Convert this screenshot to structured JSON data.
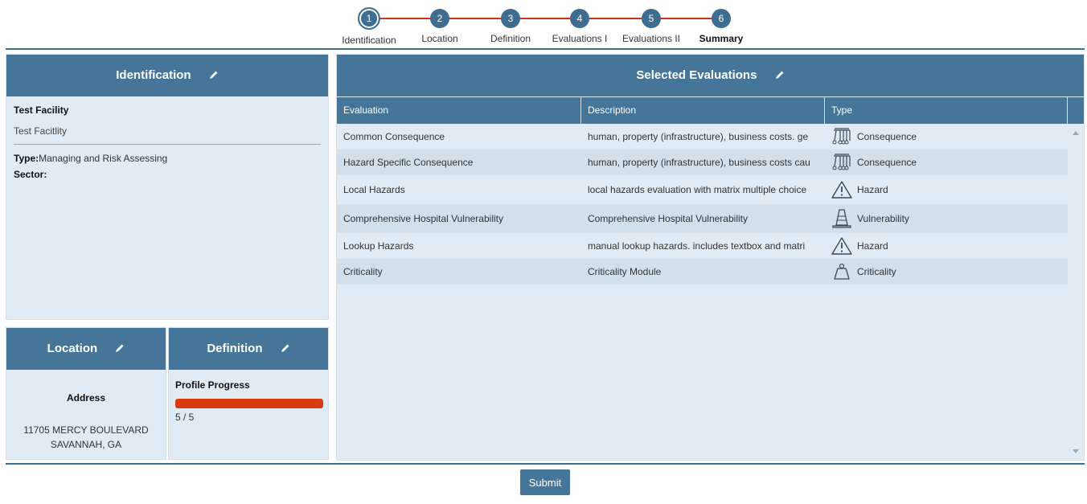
{
  "stepper": {
    "steps": [
      {
        "number": "1",
        "label": "Identification"
      },
      {
        "number": "2",
        "label": "Location"
      },
      {
        "number": "3",
        "label": "Definition"
      },
      {
        "number": "4",
        "label": "Evaluations I"
      },
      {
        "number": "5",
        "label": "Evaluations II"
      },
      {
        "number": "6",
        "label": "Summary"
      }
    ],
    "active_step": "1",
    "current_step": "6",
    "line_color": "#c7331f",
    "circle_color": "#3f6d90"
  },
  "identification": {
    "title": "Identification",
    "facility_name": "Test Facility",
    "facility_subtitle": "Test Facitlity",
    "type_label": "Type:",
    "type_value": "Managing and Risk Assessing",
    "sector_label": "Sector:",
    "sector_value": ""
  },
  "location": {
    "title": "Location",
    "address_heading": "Address",
    "address_line1": "11705 MERCY BOULEVARD",
    "address_line2": "SAVANNAH, GA"
  },
  "definition": {
    "title": "Definition",
    "progress_heading": "Profile Progress",
    "progress_fraction": 1.0,
    "progress_text": "5 / 5",
    "progress_color": "#d93a0f"
  },
  "evaluations": {
    "title": "Selected Evaluations",
    "columns": [
      "Evaluation",
      "Description",
      "Type"
    ],
    "rows": [
      {
        "evaluation": "Common Consequence",
        "description": "human, property (infrastructure), business costs. ge",
        "type": "Consequence",
        "icon": "newtons-cradle-icon"
      },
      {
        "evaluation": "Hazard Specific Consequence",
        "description": "human, property (infrastructure), business costs cau",
        "type": "Consequence",
        "icon": "newtons-cradle-icon"
      },
      {
        "evaluation": "Local Hazards",
        "description": "local hazards evaluation with matrix multiple choice",
        "type": "Hazard",
        "icon": "warning-triangle-icon"
      },
      {
        "evaluation": "Comprehensive Hospital Vulnerability",
        "description": "Comprehensive Hospital Vulnerability",
        "type": "Vulnerability",
        "icon": "traffic-cone-icon"
      },
      {
        "evaluation": "Lookup Hazards",
        "description": "manual lookup hazards. includes textbox and matri",
        "type": "Hazard",
        "icon": "warning-triangle-icon"
      },
      {
        "evaluation": "Criticality",
        "description": "Criticality Module",
        "type": "Criticality",
        "icon": "weight-icon"
      }
    ]
  },
  "submit_label": "Submit",
  "colors": {
    "header_bg": "#45769a",
    "panel_bg": "#e1ebf3",
    "row_alt_bg": "#d3e0ea"
  }
}
